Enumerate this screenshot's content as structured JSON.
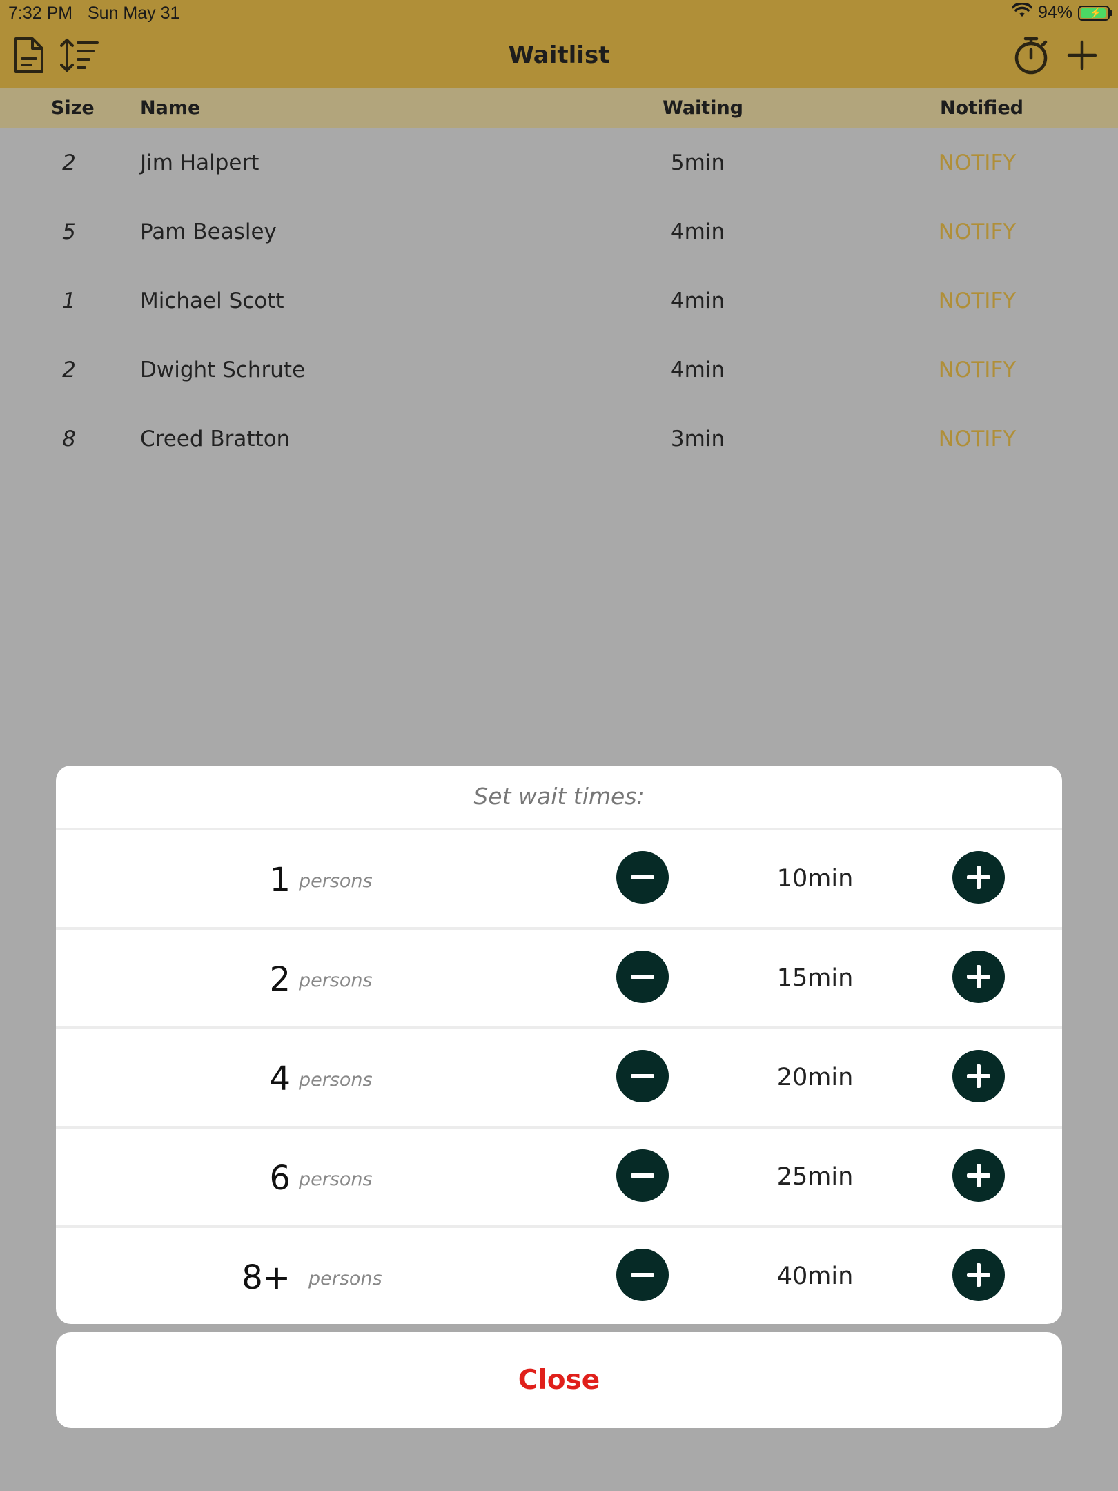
{
  "status_bar": {
    "time": "7:32 PM",
    "date": "Sun May 31",
    "battery_percent": "94%",
    "battery_level": 0.94
  },
  "nav": {
    "title": "Waitlist",
    "left_icons": [
      "document-icon",
      "sort-icon"
    ],
    "right_icons": [
      "timer-icon",
      "add-icon"
    ]
  },
  "colors": {
    "nav_bar": "#b08f38",
    "table_header": "#b2a57c",
    "notify_accent": "#b08f38",
    "stepper_button": "#062a26",
    "close_text": "#e0201b",
    "overlay": "#a9a9a9"
  },
  "table": {
    "headers": {
      "size": "Size",
      "name": "Name",
      "waiting": "Waiting",
      "notified": "Notified"
    },
    "rows": [
      {
        "size": "2",
        "name": "Jim Halpert",
        "waiting": "5min",
        "notify": "NOTIFY"
      },
      {
        "size": "5",
        "name": "Pam Beasley",
        "waiting": "4min",
        "notify": "NOTIFY"
      },
      {
        "size": "1",
        "name": "Michael Scott",
        "waiting": "4min",
        "notify": "NOTIFY"
      },
      {
        "size": "2",
        "name": "Dwight Schrute",
        "waiting": "4min",
        "notify": "NOTIFY"
      },
      {
        "size": "8",
        "name": "Creed Bratton",
        "waiting": "3min",
        "notify": "NOTIFY"
      }
    ]
  },
  "wait_times": {
    "title": "Set wait times:",
    "unit_label": "persons",
    "rows": [
      {
        "count": "1",
        "minutes": "10min"
      },
      {
        "count": "2",
        "minutes": "15min"
      },
      {
        "count": "4",
        "minutes": "20min"
      },
      {
        "count": "6",
        "minutes": "25min"
      },
      {
        "count": "8+",
        "minutes": "40min"
      }
    ],
    "close_label": "Close"
  }
}
